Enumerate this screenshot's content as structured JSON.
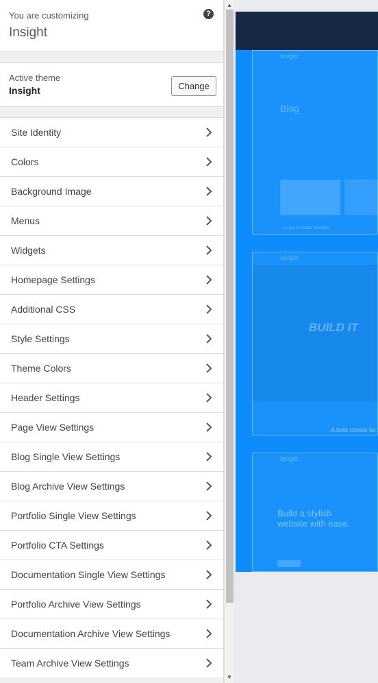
{
  "header": {
    "label": "You are customizing",
    "title": "Insight",
    "help_icon": "?"
  },
  "theme": {
    "label": "Active theme",
    "name": "Insight",
    "change_label": "Change"
  },
  "menu": [
    {
      "label": "Site Identity"
    },
    {
      "label": "Colors"
    },
    {
      "label": "Background Image"
    },
    {
      "label": "Menus"
    },
    {
      "label": "Widgets"
    },
    {
      "label": "Homepage Settings"
    },
    {
      "label": "Additional CSS"
    },
    {
      "label": "Style Settings"
    },
    {
      "label": "Theme Colors"
    },
    {
      "label": "Header Settings"
    },
    {
      "label": "Page View Settings"
    },
    {
      "label": "Blog Single View Settings"
    },
    {
      "label": "Blog Archive View Settings"
    },
    {
      "label": "Portfolio Single View Settings"
    },
    {
      "label": "Portfolio CTA Settings"
    },
    {
      "label": "Documentation Single View Settings"
    },
    {
      "label": "Portfolio Archive View Settings"
    },
    {
      "label": "Documentation Archive View Settings"
    },
    {
      "label": "Team Archive View Settings"
    }
  ],
  "preview": {
    "card1_brand": "Insight",
    "card1_heading": "Blog",
    "card1_caption": "10 tips for better websites",
    "card2_brand": "Insight",
    "card2_heading": "BUILD IT",
    "card2_caption": "A bold choice for",
    "card3_brand": "Insight",
    "card3_heading": "Build a stylish website with ease.",
    "colors": {
      "navy": "#172847",
      "blue": "#0d8dfc"
    }
  }
}
